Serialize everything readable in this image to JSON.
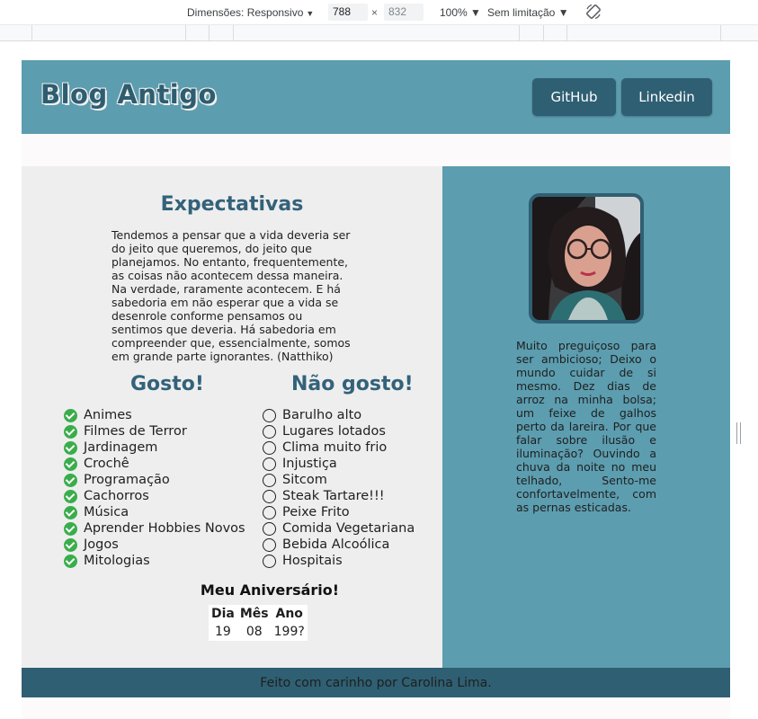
{
  "devtools": {
    "dimensions_label": "Dimensões: Responsivo",
    "width": "788",
    "height": "832",
    "times": "×",
    "zoom": "100%",
    "throttle": "Sem limitação"
  },
  "header": {
    "logo": "Blog Antigo",
    "github_label": "GitHub",
    "linkedin_label": "Linkedin"
  },
  "expectations": {
    "title": "Expectativas",
    "text": "Tendemos a pensar que a vida deveria ser do jeito que queremos, do jeito que planejamos. No entanto, frequentemente, as coisas não acontecem dessa maneira. Na verdade, raramente acontecem. E há sabedoria em não esperar que a vida se desenrole conforme pensamos ou sentimos que deveria. Há sabedoria em compreender que, essencialmente, somos em grande parte ignorantes. (Natthiko)"
  },
  "likes": {
    "title": "Gosto!",
    "items": [
      "Animes",
      "Filmes de Terror",
      "Jardinagem",
      "Crochê",
      "Programação",
      "Cachorros",
      "Música",
      "Aprender Hobbies Novos",
      "Jogos",
      "Mitologias"
    ]
  },
  "dislikes": {
    "title": "Não gosto!",
    "items": [
      "Barulho alto",
      "Lugares lotados",
      "Clima muito frio",
      "Injustiça",
      "Sitcom",
      "Steak Tartare!!!",
      "Peixe Frito",
      "Comida Vegetariana",
      "Bebida Alcoólica",
      "Hospitais"
    ]
  },
  "birthday": {
    "title": "Meu Aniversário!",
    "headers": [
      "Dia",
      "Mês",
      "Ano"
    ],
    "values": [
      "19",
      "08",
      "199?"
    ]
  },
  "bio": {
    "text": "Muito preguiçoso para ser ambicioso; Deixo o mundo cuidar de si mesmo. Dez dias de arroz na minha bolsa; um feixe de galhos perto da lareira. Por que falar sobre ilusão e iluminação? Ouvindo a chuva da noite no meu telhado, Sento-me confortavelmente, com as pernas esticadas."
  },
  "footer": {
    "text": "Feito com carinho por Carolina Lima."
  },
  "colors": {
    "header_bg": "#5c9daf",
    "accent_dark": "#2f5f72",
    "title_text": "#33627a",
    "left_bg": "#eeeeee",
    "check_green": "#3aad4b"
  }
}
